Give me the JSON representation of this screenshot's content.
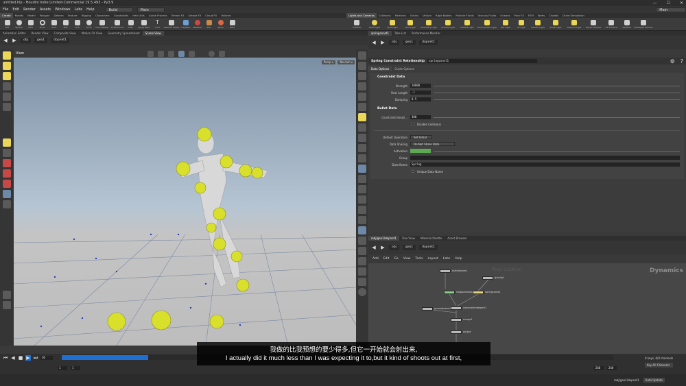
{
  "app": {
    "title": "untitled.hip - Houdini Indie Limited-Commercial 19.5.493 - Py3.9",
    "window_controls": [
      "—",
      "☐",
      "✕"
    ]
  },
  "menu": {
    "items": [
      "File",
      "Edit",
      "Render",
      "Assets",
      "Windows",
      "Labs",
      "Help"
    ],
    "build_dropdown": "Build",
    "desktop_dropdown": "Main",
    "right_desktop": "Main"
  },
  "shelf_left": {
    "tabs": [
      "Create",
      "Modify",
      "Model",
      "Polygon",
      "Deform",
      "Texture",
      "Rigging",
      "Characters",
      "Constraints",
      "Hair Utils",
      "Guide Process",
      "Terrain FX",
      "Simple FX",
      "Cloud FX",
      "Volume"
    ],
    "tools": [
      "Box",
      "Sphere",
      "Tube",
      "Torus",
      "Grid",
      "Null",
      "Line",
      "Circle",
      "Curve Bezier",
      "Draw Curve",
      "Path",
      "Spray Paint",
      "Font",
      "Platonic Solids",
      "L-System",
      "Metaball",
      "File",
      "Spiral",
      "Helix"
    ]
  },
  "shelf_right": {
    "tabs": [
      "Lights and Cameras",
      "Collisions",
      "Particles",
      "Grains",
      "Vellum",
      "Rigid Bodies",
      "Particle Fluids",
      "Viscous Fluids",
      "Oceans",
      "Pyro FX",
      "FEM",
      "Wires",
      "Crowds",
      "Drive Simulation"
    ],
    "tools": [
      "Camera",
      "Point Light",
      "Spot Light",
      "Area Light",
      "Geometry Light",
      "Volume Light",
      "Distant Light",
      "Environment Light",
      "Sky Light",
      "GI Light",
      "Caustic Light",
      "Portal Light",
      "Ambient Light",
      "Stereo Camera",
      "VR Camera",
      "Switcher",
      "Gamepad Camera"
    ]
  },
  "left_panes": {
    "tabs": [
      "Animation Editor",
      "Render View",
      "Composite View",
      "Motion FX View",
      "Geometry Spreadsheet",
      "Scene View"
    ],
    "path": [
      "obj",
      "geo1",
      "dopnet1"
    ],
    "viewport_label": "View",
    "persp": "Persp ▾",
    "no_cam": "No cam ▾"
  },
  "right_panes": {
    "top_tabs": [
      "springconst1",
      "Take List",
      "Performance Monitor"
    ],
    "path": [
      "obj",
      "geo1",
      "dopnet1"
    ],
    "node_type": "Spring Constraint Relationship",
    "node_name": "springconst1",
    "param_tabs": [
      "Data Options",
      "Guide Options"
    ],
    "constraint_section": "Constraint Data",
    "bullet_section": "Bullet Data",
    "params": {
      "strength_label": "Strength",
      "strength": "10000",
      "rest_length_label": "Rest Length",
      "rest_length": "-1",
      "damping_label": "Damping",
      "damping": "0.5",
      "iterations_label": "Constraint Iterati...",
      "iterations": "300",
      "disable_collisions": "Disable Collisions",
      "default_op_label": "Default Operation",
      "default_op": "Set Initial",
      "data_sharing_label": "Data Sharing",
      "data_sharing": "Do Not Share Data",
      "activation_label": "Activation",
      "group_label": "Group",
      "data_name_label": "Data Name",
      "data_name": "Spring",
      "unique_data_name": "Unique Data Name"
    }
  },
  "network": {
    "tabs": [
      "/obj/geo1/dopnet1",
      "Tree View",
      "Material Palette",
      "Asset Browser"
    ],
    "path": [
      "obj",
      "geo1",
      "dopnet1"
    ],
    "menu": [
      "Add",
      "Edit",
      "Go",
      "View",
      "Tools",
      "Layout",
      "Labs",
      "Help"
    ],
    "context_label": "Dynamics",
    "watermark": "Ptuts CG/Anim",
    "nodes": [
      "bulletsolver1",
      "gravity1",
      "rbdpackedobject1",
      "springconst1",
      "constraintnetwork1",
      "groundplane1",
      "merge1",
      "output"
    ]
  },
  "timeline": {
    "frame": "30",
    "start": "1",
    "start2": "1",
    "end": "240",
    "end2": "240",
    "keys_label": "0 keys, 0/0 channels",
    "key_all": "Key All Channels",
    "auto_update": "Auto Update",
    "status_path": "/obj/geo1/dopnet1"
  },
  "subtitles": {
    "cn": "我做的比我预想的要少得多,但它一开始就会射出来,",
    "en": "I actually did it much less than I was expecting it to,but it kind of shoots out at first,"
  },
  "colors": {
    "accent_blue": "#1f6fd0",
    "chunk_yellow": "#d8e02c",
    "activation_green": "#5cab52",
    "node_green": "#8ad08a",
    "node_yellow": "#e3d57a"
  }
}
